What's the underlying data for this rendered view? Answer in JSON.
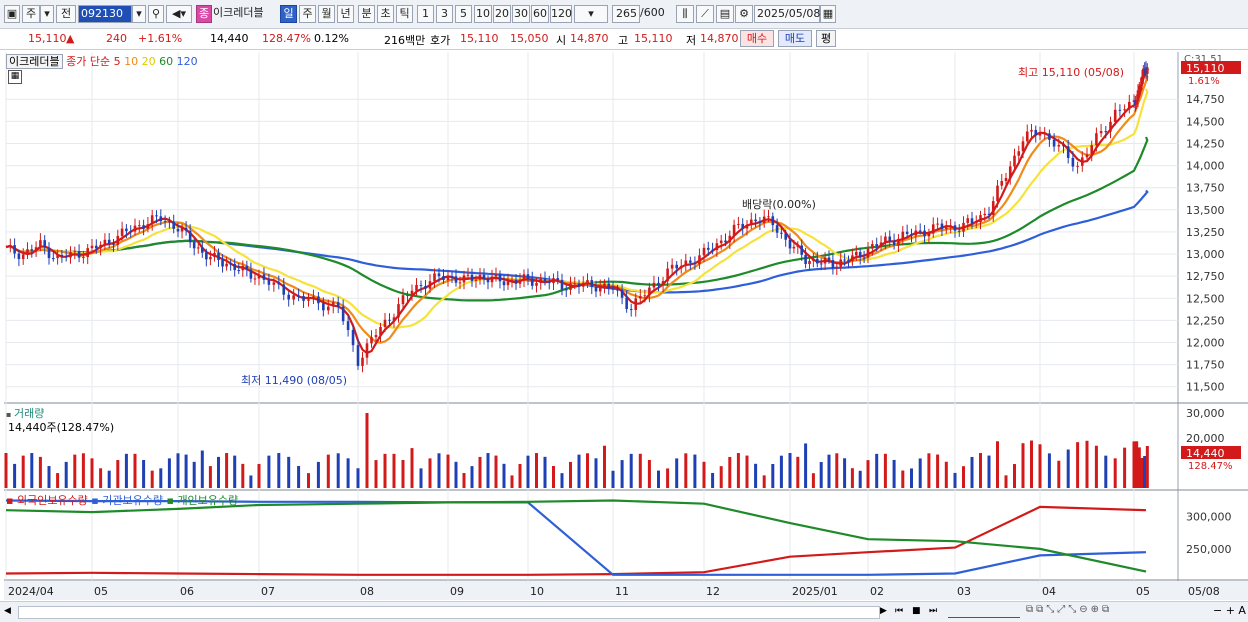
{
  "toolbar": {
    "market": "주",
    "prev_label": "전",
    "code": "092130",
    "name": "이크레더블",
    "badge_prefix": "종",
    "periods": [
      "일",
      "주",
      "월",
      "년",
      "분",
      "초",
      "틱"
    ],
    "intervals": [
      "1",
      "3",
      "5",
      "10",
      "20",
      "30",
      "60",
      "120"
    ],
    "count": "265",
    "count_total": "/600",
    "date": "2025/05/08"
  },
  "info": {
    "price": "15,110",
    "up_symbol": "▲",
    "change": "240",
    "change_pct": "+1.61%",
    "volume": "14,440",
    "vol_ratio": "128.47%",
    "turnover": "0.12%",
    "amount": "216백만",
    "ask_label": "호가",
    "ask1": "15,110",
    "ask2": "15,050",
    "open_label": "시",
    "open": "14,870",
    "high_label": "고",
    "high": "15,110",
    "low_label": "저",
    "low": "14,870",
    "buy_label": "매수",
    "sell_label": "매도",
    "avg_label": "평"
  },
  "panels": {
    "price_legend_name": "이크레더블",
    "price_legend_ma": "종가 단순",
    "ma_periods": [
      "5",
      "10",
      "20",
      "60",
      "120"
    ],
    "volume_title": "거래량",
    "volume_info": "14,440주(128.47%)",
    "holding_titles": [
      "외국인보유수량",
      "기관보유수량",
      "개인보유수량"
    ]
  },
  "colors": {
    "up": "#d21a1a",
    "down": "#1f3fb5",
    "ma5": "#d21a1a",
    "ma10": "#f08a18",
    "ma20": "#f5e23a",
    "ma60": "#1e8a2a",
    "ma120": "#2f5fd8",
    "foreign": "#d21a1a",
    "institution": "#2f5fd8",
    "individual": "#1e8a2a"
  },
  "chart_data": [
    {
      "type": "candlestick",
      "price_axis_ticks": [
        11500,
        11750,
        12000,
        12250,
        12500,
        12750,
        13000,
        13250,
        13500,
        13750,
        14000,
        14250,
        14500,
        14750
      ],
      "ylim": [
        11350,
        15250
      ],
      "x_labels": [
        "2024/04",
        "05",
        "06",
        "07",
        "08",
        "09",
        "10",
        "11",
        "12",
        "2025/01",
        "02",
        "03",
        "04",
        "05"
      ],
      "right_date": "05/08",
      "current_price": "15,110",
      "current_pct": "1.61%",
      "top_label": "C:31.51",
      "max_annotation": "최고 15,110 (05/08)",
      "min_annotation": "최저 11,490 (08/05)",
      "dividend_annotation": "배당락(0.00%)",
      "series_close": [
        {
          "month": "2024/04",
          "values": [
            13050,
            13000,
            13100,
            12950,
            13000
          ]
        },
        {
          "month": "05",
          "values": [
            13050,
            13150,
            13250,
            13350,
            13400
          ]
        },
        {
          "month": "06",
          "values": [
            13300,
            13100,
            12950,
            12900,
            12800
          ]
        },
        {
          "month": "07",
          "values": [
            12750,
            12600,
            12500,
            12450,
            12400
          ]
        },
        {
          "month": "08",
          "values": [
            11800,
            12100,
            12350,
            12600,
            12700
          ]
        },
        {
          "month": "09",
          "values": [
            12750,
            12700,
            12750,
            12700,
            12700
          ]
        },
        {
          "month": "10",
          "values": [
            12700,
            12700,
            12650,
            12650,
            12650
          ]
        },
        {
          "month": "11",
          "values": [
            12600,
            12400,
            12600,
            12800,
            12900
          ]
        },
        {
          "month": "12",
          "values": [
            13000,
            13150,
            13300,
            13400,
            13350
          ]
        },
        {
          "month": "2025/01",
          "values": [
            13100,
            12950,
            12900,
            12900,
            12950
          ]
        },
        {
          "month": "02",
          "values": [
            13050,
            13150,
            13200,
            13250,
            13300
          ]
        },
        {
          "month": "03",
          "values": [
            13300,
            13350,
            13500,
            13900,
            14300
          ]
        },
        {
          "month": "04",
          "values": [
            14400,
            14200,
            14000,
            14300,
            14600
          ]
        },
        {
          "month": "05",
          "values": [
            14700,
            14870,
            15110
          ]
        }
      ]
    },
    {
      "type": "bar",
      "name": "거래량",
      "y_axis_ticks": [
        20000,
        30000
      ],
      "ylim": [
        0,
        32000
      ],
      "current_value": "14,440",
      "current_pct": "128.47%"
    },
    {
      "type": "line",
      "series_names": [
        "외국인보유수량",
        "기관보유수량",
        "개인보유수량"
      ],
      "y_axis_ticks": [
        250000,
        300000
      ],
      "ylim": [
        205000,
        335000
      ],
      "series": [
        {
          "name": "외국인보유수량",
          "months": [
            "2024/04",
            "05",
            "06",
            "07",
            "08",
            "09",
            "10",
            "11",
            "12",
            "2025/01",
            "02",
            "03",
            "04",
            "05"
          ],
          "values": [
            212000,
            213000,
            212000,
            211000,
            210000,
            210000,
            210000,
            211000,
            214000,
            238000,
            245000,
            252000,
            315000,
            310000
          ]
        },
        {
          "name": "기관보유수량",
          "months": [
            "2024/04",
            "05",
            "06",
            "07",
            "08",
            "09",
            "10",
            "11",
            "12",
            "2025/01",
            "02",
            "03",
            "04",
            "05"
          ],
          "values": [
            325000,
            324000,
            324000,
            323000,
            323000,
            322000,
            322000,
            210000,
            210000,
            210000,
            210000,
            212000,
            240000,
            245000
          ]
        },
        {
          "name": "개인보유수량",
          "months": [
            "2024/04",
            "05",
            "06",
            "07",
            "08",
            "09",
            "10",
            "11",
            "12",
            "2025/01",
            "02",
            "03",
            "04",
            "05"
          ],
          "values": [
            310000,
            307000,
            312000,
            318000,
            320000,
            322000,
            323000,
            325000,
            320000,
            290000,
            265000,
            262000,
            250000,
            215000
          ]
        }
      ]
    }
  ]
}
